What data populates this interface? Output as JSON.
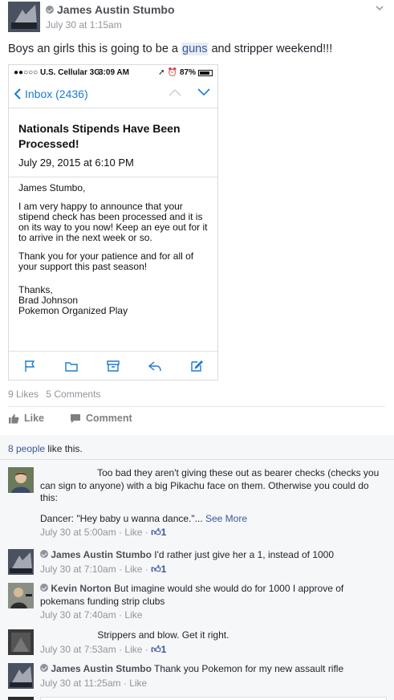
{
  "post": {
    "author": "James Austin Stumbo",
    "timestamp": "July 30 at 1:15am",
    "text_before": "Boys an girls this is going to be a ",
    "text_highlight": "guns",
    "text_after": " and stripper weekend!!!"
  },
  "screenshot": {
    "status_carrier": "●●○○○ U.S. Cellular  3G",
    "status_time": "3:09 AM",
    "status_battery": "87%",
    "back_label": "Inbox (2436)",
    "subject": "Nationals Stipends Have Been Processed!",
    "date": "July 29, 2015 at 6:10 PM",
    "greeting": "James Stumbo,",
    "para1": "I am very happy to announce that your stipend check has been processed and it is on its way to you now! Keep an eye out for it to arrive in the next week or so.",
    "para2": "Thank you for your patience and for all of your support this past season!",
    "sign1": "Thanks,",
    "sign2": "Brad Johnson",
    "sign3": "Pokemon Organized Play"
  },
  "counts": {
    "likes": "9 Likes",
    "comments": "5 Comments"
  },
  "actions": {
    "like": "Like",
    "comment": "Comment"
  },
  "likers": {
    "link": "8 people",
    "suffix": " like this."
  },
  "comments": [
    {
      "author": "",
      "text": "Too bad they aren't giving these out as bearer checks (checks you can sign to anyone) with a big Pikachu face on them. Otherwise you could do this:",
      "text2": "Dancer: \"Hey baby u wanna dance.\"...",
      "see_more": "See More",
      "time": "July 30 at 5:00am",
      "like": "Like",
      "reactions": "1"
    },
    {
      "author": "James Austin Stumbo",
      "text": "I'd rather just give her a 1, instead of 1000",
      "time": "July 30 at 7:10am",
      "like": "Like",
      "reactions": "1"
    },
    {
      "author": "Kevin Norton",
      "text": "But imagine would she would do for 1000 I approve of pokemans funding strip clubs",
      "time": "July 30 at 7:40am",
      "like": "Like"
    },
    {
      "author": "",
      "text": "Strippers and blow. Get it right.",
      "time": "July 30 at 7:53am",
      "like": "Like",
      "reactions": "1"
    },
    {
      "author": "James Austin Stumbo",
      "text": "Thank you Pokemon for my new assault rifle",
      "time": "July 30 at 11:25am",
      "like": "Like"
    }
  ]
}
